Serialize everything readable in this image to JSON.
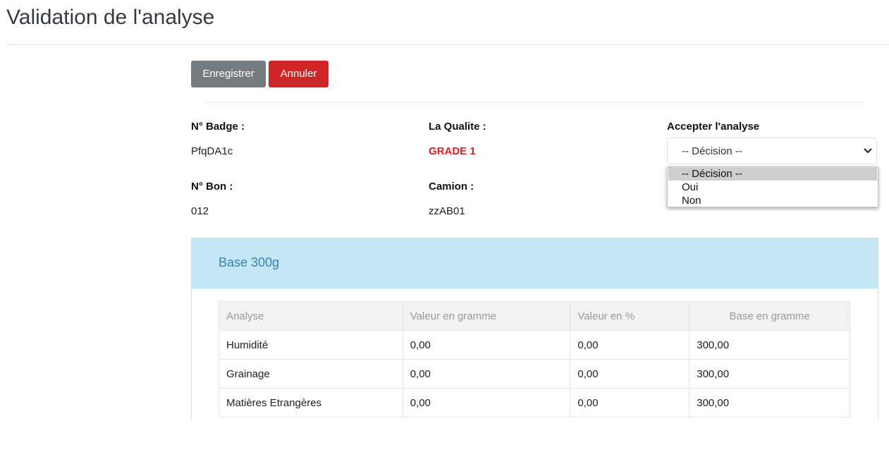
{
  "page": {
    "title": "Validation de l'analyse"
  },
  "actions": {
    "save_label": "Enregistrer",
    "cancel_label": "Annuler"
  },
  "details": {
    "badge_label": "N° Badge :",
    "badge_value": "PfqDA1c",
    "quality_label": "La Qualite :",
    "quality_value": "GRADE 1",
    "accept_label": "Accepter l'analyse",
    "bon_label": "N° Bon :",
    "bon_value": "012",
    "truck_label": "Camion :",
    "truck_value": "zzAB01"
  },
  "decision_select": {
    "selected": "-- Décision --",
    "options": [
      "-- Décision --",
      "Oui",
      "Non"
    ]
  },
  "card": {
    "title": "Base 300g"
  },
  "table": {
    "headers": [
      "Analyse",
      "Valeur en gramme",
      "Valeur en %",
      "Base en gramme"
    ],
    "rows": [
      [
        "Humidité",
        "0,00",
        "0,00",
        "300,00"
      ],
      [
        "Grainage",
        "0,00",
        "0,00",
        "300,00"
      ],
      [
        "Matières Etrangères",
        "0,00",
        "0,00",
        "300,00"
      ]
    ]
  },
  "colors": {
    "save_button": "#767b80",
    "cancel_button": "#d02526",
    "grade_text": "#dd1f1f",
    "card_header": "#c4e7f5",
    "card_title": "#3a80a3"
  }
}
